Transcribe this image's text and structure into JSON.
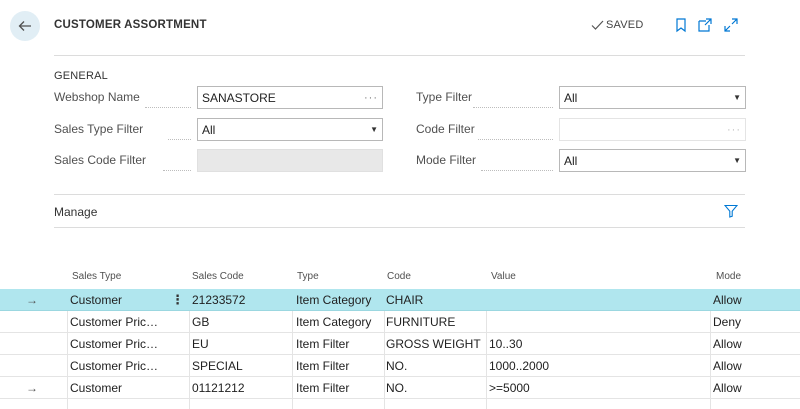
{
  "header": {
    "title": "CUSTOMER ASSORTMENT",
    "saved_label": "SAVED"
  },
  "general": {
    "caption": "GENERAL",
    "webshop_name": {
      "label": "Webshop Name",
      "value": "SANASTORE"
    },
    "sales_type_filter": {
      "label": "Sales Type Filter",
      "value": "All"
    },
    "sales_code_filter": {
      "label": "Sales Code Filter",
      "value": ""
    },
    "type_filter": {
      "label": "Type Filter",
      "value": "All"
    },
    "code_filter": {
      "label": "Code Filter",
      "value": ""
    },
    "mode_filter": {
      "label": "Mode Filter",
      "value": "All"
    }
  },
  "manage": {
    "label": "Manage"
  },
  "table": {
    "columns": {
      "sales_type": "Sales Type",
      "sales_code": "Sales Code",
      "type": "Type",
      "code": "Code",
      "value": "Value",
      "mode": "Mode"
    },
    "rows": [
      {
        "sales_type": "Customer",
        "sales_code": "21233572",
        "type": "Item Category",
        "code": "CHAIR",
        "value": "",
        "mode": "Allow"
      },
      {
        "sales_type": "Customer Price...",
        "sales_code": "GB",
        "type": "Item Category",
        "code": "FURNITURE",
        "value": "",
        "mode": "Deny"
      },
      {
        "sales_type": "Customer Price...",
        "sales_code": "EU",
        "type": "Item Filter",
        "code": "GROSS WEIGHT",
        "value": "10..30",
        "mode": "Allow"
      },
      {
        "sales_type": "Customer Price...",
        "sales_code": "SPECIAL",
        "type": "Item Filter",
        "code": "NO.",
        "value": "1000..2000",
        "mode": "Allow"
      },
      {
        "sales_type": "Customer",
        "sales_code": "01121212",
        "type": "Item Filter",
        "code": "NO.",
        "value": ">=5000",
        "mode": "Allow"
      }
    ]
  },
  "colors": {
    "accent": "#0078d4",
    "selected_row": "#b0e6ee",
    "back_button_bg": "#e1eef5"
  },
  "icons": {
    "back": "arrow-left-icon",
    "saved": "checkmark-icon",
    "bookmark": "bookmark-icon",
    "open_new": "open-in-new-window-icon",
    "expand": "expand-icon",
    "filter": "filter-icon",
    "assist": "ellipsis-icon",
    "dropdown": "caret-down-icon",
    "row_pointer": "arrow-right-icon",
    "row_menu": "kebab-menu-icon"
  }
}
